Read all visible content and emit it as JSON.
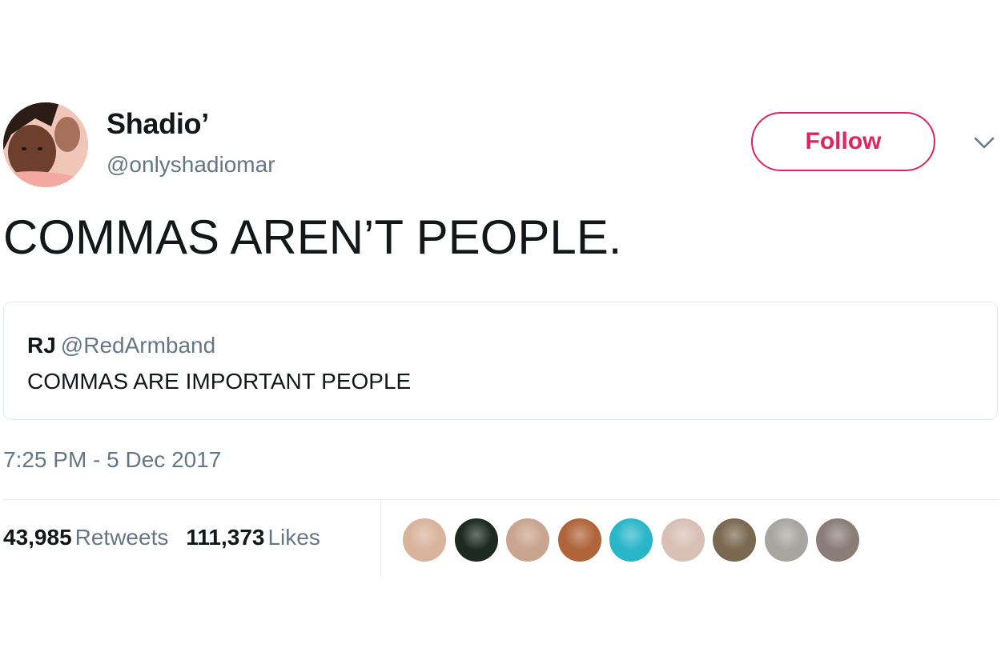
{
  "author": {
    "display_name": "Shadio’",
    "screen_name": "@onlyshadiomar"
  },
  "actions": {
    "follow_label": "Follow",
    "accent_color": "#e0245e"
  },
  "icons": {
    "more": "chevron-down-icon"
  },
  "tweet": {
    "text": "COMMAS AREN’T PEOPLE.",
    "timestamp": "7:25 PM - 5 Dec 2017"
  },
  "quoted_tweet": {
    "name": "RJ",
    "handle": "@RedArmband",
    "text": "COMMAS ARE IMPORTANT PEOPLE"
  },
  "stats": {
    "retweets_count": "43,985",
    "retweets_label": "Retweets",
    "likes_count": "111,373",
    "likes_label": "Likes"
  },
  "likers": [
    {
      "color": "#d9b39c"
    },
    {
      "color": "#1d2a22"
    },
    {
      "color": "#c9a48e"
    },
    {
      "color": "#b0643a"
    },
    {
      "color": "#2ab6c9"
    },
    {
      "color": "#d8c0b5"
    },
    {
      "color": "#7a6850"
    },
    {
      "color": "#a8a4a0"
    },
    {
      "color": "#8a7d78"
    }
  ]
}
